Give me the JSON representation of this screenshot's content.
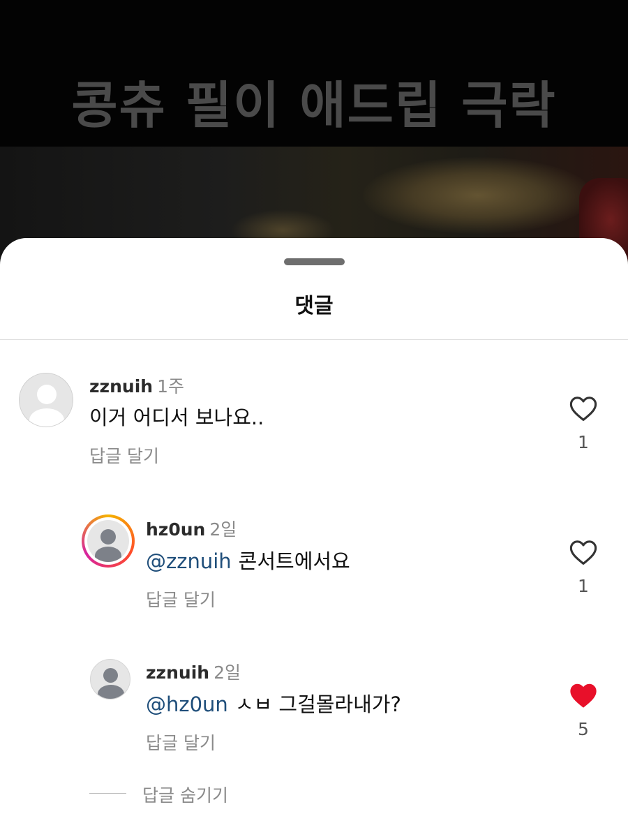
{
  "video": {
    "caption": "콩츄 필이 애드립 극락"
  },
  "sheet": {
    "title": "댓글"
  },
  "comments": [
    {
      "username": "zznuih",
      "time": "1주",
      "mention": "",
      "text": "이거 어디서 보나요..",
      "reply_label": "답글 달기",
      "likes": "1",
      "liked": false
    },
    {
      "username": "hz0un",
      "time": "2일",
      "mention": "@zznuih",
      "text": "콘서트에서요",
      "reply_label": "답글 달기",
      "likes": "1",
      "liked": false
    },
    {
      "username": "zznuih",
      "time": "2일",
      "mention": "@hz0un",
      "text": "ㅅㅂ 그걸몰라내가?",
      "reply_label": "답글 달기",
      "likes": "5",
      "liked": true
    }
  ],
  "hide_replies_label": "답글 숨기기",
  "colors": {
    "mention": "#1f4e7a",
    "liked_heart": "#e8102a",
    "story_ring_start": "#f5b300",
    "story_ring_end": "#d6249f"
  },
  "icons": {
    "like": "heart-outline-icon",
    "liked": "heart-filled-icon"
  }
}
